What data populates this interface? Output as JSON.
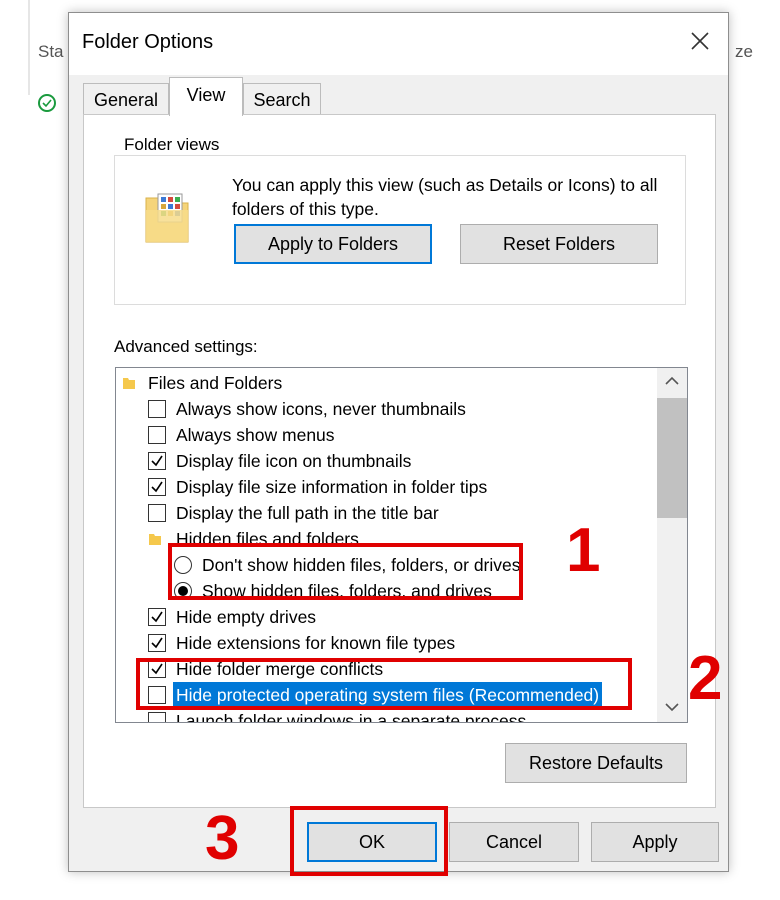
{
  "background": {
    "left_label": "Sta",
    "right_label": "ze"
  },
  "dialog": {
    "title": "Folder Options",
    "tabs": [
      {
        "label": "General",
        "active": false
      },
      {
        "label": "View",
        "active": true
      },
      {
        "label": "Search",
        "active": false
      }
    ],
    "folder_views": {
      "title": "Folder views",
      "description": "You can apply this view (such as Details or Icons) to all folders of this type.",
      "apply_button": "Apply to Folders",
      "reset_button": "Reset Folders"
    },
    "advanced_settings_label": "Advanced settings:",
    "advanced_items": [
      {
        "type": "folder",
        "label": "Files and Folders"
      },
      {
        "type": "checkbox",
        "label": "Always show icons, never thumbnails",
        "checked": false
      },
      {
        "type": "checkbox",
        "label": "Always show menus",
        "checked": false
      },
      {
        "type": "checkbox",
        "label": "Display file icon on thumbnails",
        "checked": true
      },
      {
        "type": "checkbox",
        "label": "Display file size information in folder tips",
        "checked": true
      },
      {
        "type": "checkbox",
        "label": "Display the full path in the title bar",
        "checked": false
      },
      {
        "type": "folder",
        "label": "Hidden files and folders"
      },
      {
        "type": "radio",
        "label": "Don't show hidden files, folders, or drives",
        "checked": false
      },
      {
        "type": "radio",
        "label": "Show hidden files, folders, and drives",
        "checked": true
      },
      {
        "type": "checkbox",
        "label": "Hide empty drives",
        "checked": true
      },
      {
        "type": "checkbox",
        "label": "Hide extensions for known file types",
        "checked": true
      },
      {
        "type": "checkbox",
        "label": "Hide folder merge conflicts",
        "checked": true
      },
      {
        "type": "checkbox",
        "label": "Hide protected operating system files (Recommended)",
        "checked": false,
        "selected": true
      },
      {
        "type": "checkbox",
        "label": "Launch folder windows in a separate process",
        "checked": false
      }
    ],
    "restore_defaults_button": "Restore Defaults",
    "ok_button": "OK",
    "cancel_button": "Cancel",
    "apply_button": "Apply"
  },
  "annotations": [
    "1",
    "2",
    "3"
  ],
  "colors": {
    "annotation": "#e00000",
    "selection": "#0078d7",
    "focus": "#0078d7"
  }
}
